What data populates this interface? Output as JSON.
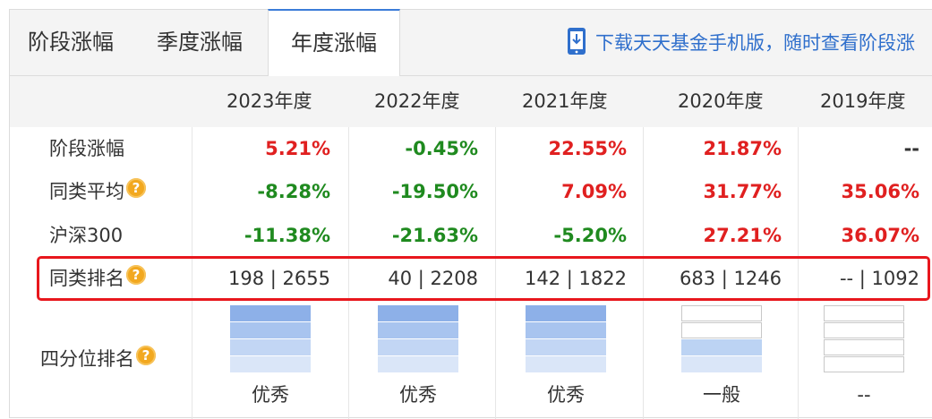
{
  "tabs": [
    {
      "label": "阶段涨幅",
      "active": false
    },
    {
      "label": "季度涨幅",
      "active": false
    },
    {
      "label": "年度涨幅",
      "active": true
    }
  ],
  "promo": {
    "text": "下载天天基金手机版，随时查看阶段涨",
    "icon": "phone-download-icon"
  },
  "table": {
    "columns": [
      "2023年度",
      "2022年度",
      "2021年度",
      "2020年度",
      "2019年度"
    ],
    "rows": [
      {
        "label": "阶段涨幅",
        "help": false,
        "values": [
          "5.21%",
          "-0.45%",
          "22.55%",
          "21.87%",
          "--"
        ]
      },
      {
        "label": "同类平均",
        "help": true,
        "values": [
          "-8.28%",
          "-19.50%",
          "7.09%",
          "31.77%",
          "35.06%"
        ]
      },
      {
        "label": "沪深300",
        "help": false,
        "values": [
          "-11.38%",
          "-21.63%",
          "-5.20%",
          "27.21%",
          "36.07%"
        ]
      },
      {
        "label": "同类排名",
        "help": true,
        "values": [
          "198 | 2655",
          "40 | 2208",
          "142 | 1822",
          "683 | 1246",
          "-- | 1092"
        ]
      }
    ],
    "quartile": {
      "label": "四分位排名",
      "help": true,
      "levels": [
        "excellent",
        "excellent",
        "excellent",
        "average",
        "none"
      ],
      "texts": [
        "优秀",
        "优秀",
        "优秀",
        "一般",
        "--"
      ]
    }
  },
  "help_glyph": "?",
  "colors": {
    "up": "#e02020",
    "down": "#1f8a1f",
    "accent": "#3b7cd8",
    "highlight": "#e8171d"
  }
}
